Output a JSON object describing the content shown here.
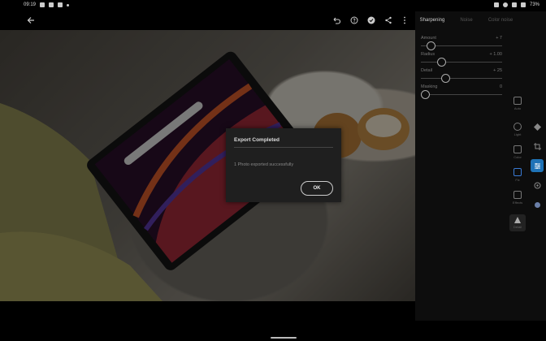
{
  "status_bar": {
    "time": "09:19",
    "battery": "73%"
  },
  "panel": {
    "tabs": [
      {
        "label": "Sharpening",
        "active": true
      },
      {
        "label": "Noise",
        "active": false
      },
      {
        "label": "Color noise",
        "active": false
      }
    ],
    "sliders": [
      {
        "label": "Amount",
        "value": "+ 7",
        "fraction": 0.07
      },
      {
        "label": "Radius",
        "value": "+ 1.00",
        "fraction": 0.2
      },
      {
        "label": "Detail",
        "value": "+ 25",
        "fraction": 0.25
      },
      {
        "label": "Masking",
        "value": "0",
        "fraction": 0.0
      }
    ],
    "tools": [
      {
        "label": "Auto",
        "icon": "auto-icon"
      },
      {
        "label": "Light",
        "icon": "sun-icon"
      },
      {
        "label": "Color",
        "icon": "thermometer-icon"
      },
      {
        "label": "Fix",
        "icon": "brush-icon"
      },
      {
        "label": "Effects",
        "icon": "square-icon"
      },
      {
        "label": "Detail",
        "icon": "triangle-icon"
      }
    ]
  },
  "dialog": {
    "title": "Export Completed",
    "message": "1 Photo exported successfully",
    "ok_label": "OK"
  },
  "colors": {
    "accent": "#1f73b7",
    "panel_bg": "#0d0d0d",
    "dialog_bg": "#1f1f1f"
  }
}
